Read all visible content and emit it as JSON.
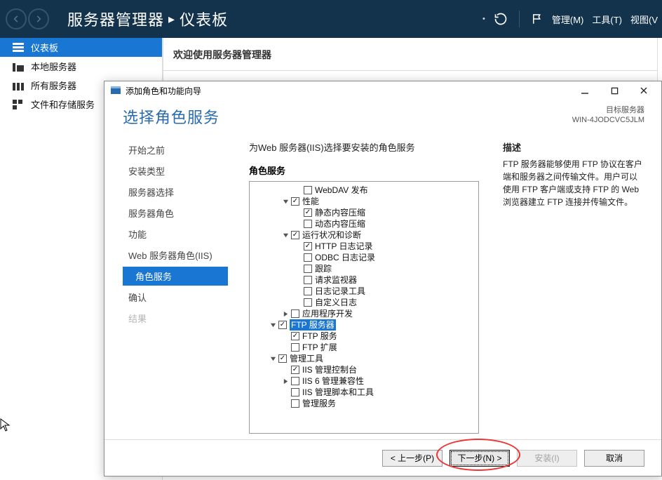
{
  "header": {
    "crumb_app": "服务器管理器",
    "crumb_page": "仪表板",
    "menu_manage": "管理(M)",
    "menu_tools": "工具(T)",
    "menu_view": "视图(V"
  },
  "sidebar": {
    "items": [
      {
        "label": "仪表板",
        "selected": true,
        "icon": "bars"
      },
      {
        "label": "本地服务器",
        "selected": false,
        "icon": "local"
      },
      {
        "label": "所有服务器",
        "selected": false,
        "icon": "all"
      },
      {
        "label": "文件和存储服务",
        "selected": false,
        "icon": "stor"
      }
    ]
  },
  "main": {
    "welcome": "欢迎使用服务器管理器"
  },
  "wizard": {
    "title": "添加角色和功能向导",
    "heading": "选择角色服务",
    "dest_label": "目标服务器",
    "dest_value": "WIN-4JODCVC5JLM",
    "steps": [
      {
        "label": "开始之前"
      },
      {
        "label": "安装类型"
      },
      {
        "label": "服务器选择"
      },
      {
        "label": "服务器角色"
      },
      {
        "label": "功能"
      },
      {
        "label": "Web 服务器角色(IIS)"
      },
      {
        "label": "角色服务",
        "selected": true,
        "indent": true
      },
      {
        "label": "确认"
      },
      {
        "label": "结果",
        "disabled": true
      }
    ],
    "prompt": "为Web 服务器(IIS)选择要安装的角色服务",
    "tree_heading": "角色服务",
    "tree": [
      {
        "d": 3,
        "ex": "",
        "chk": false,
        "label": "WebDAV 发布"
      },
      {
        "d": 2,
        "ex": "open",
        "chk": true,
        "label": "性能"
      },
      {
        "d": 3,
        "ex": "",
        "chk": true,
        "label": "静态内容压缩"
      },
      {
        "d": 3,
        "ex": "",
        "chk": false,
        "label": "动态内容压缩"
      },
      {
        "d": 2,
        "ex": "open",
        "chk": true,
        "label": "运行状况和诊断"
      },
      {
        "d": 3,
        "ex": "",
        "chk": true,
        "label": "HTTP 日志记录"
      },
      {
        "d": 3,
        "ex": "",
        "chk": false,
        "label": "ODBC 日志记录"
      },
      {
        "d": 3,
        "ex": "",
        "chk": false,
        "label": "跟踪"
      },
      {
        "d": 3,
        "ex": "",
        "chk": false,
        "label": "请求监视器"
      },
      {
        "d": 3,
        "ex": "",
        "chk": false,
        "label": "日志记录工具"
      },
      {
        "d": 3,
        "ex": "",
        "chk": false,
        "label": "自定义日志"
      },
      {
        "d": 2,
        "ex": "closed",
        "chk": false,
        "label": "应用程序开发"
      },
      {
        "d": 1,
        "ex": "open",
        "chk": true,
        "label": "FTP 服务器",
        "sel": true
      },
      {
        "d": 2,
        "ex": "",
        "chk": true,
        "label": "FTP 服务"
      },
      {
        "d": 2,
        "ex": "",
        "chk": false,
        "label": "FTP 扩展"
      },
      {
        "d": 1,
        "ex": "open",
        "chk": true,
        "label": "管理工具"
      },
      {
        "d": 2,
        "ex": "",
        "chk": true,
        "label": "IIS 管理控制台"
      },
      {
        "d": 2,
        "ex": "closed",
        "chk": false,
        "label": "IIS 6 管理兼容性"
      },
      {
        "d": 2,
        "ex": "",
        "chk": false,
        "label": "IIS 管理脚本和工具"
      },
      {
        "d": 2,
        "ex": "",
        "chk": false,
        "label": "管理服务"
      }
    ],
    "desc_heading": "描述",
    "desc_text": "FTP 服务器能够使用 FTP 协议在客户端和服务器之间传输文件。用户可以使用 FTP 客户端或支持 FTP 的 Web 浏览器建立 FTP 连接并传输文件。",
    "buttons": {
      "prev": "< 上一步(P)",
      "next": "下一步(N) >",
      "install": "安装(I)",
      "cancel": "取消"
    }
  }
}
